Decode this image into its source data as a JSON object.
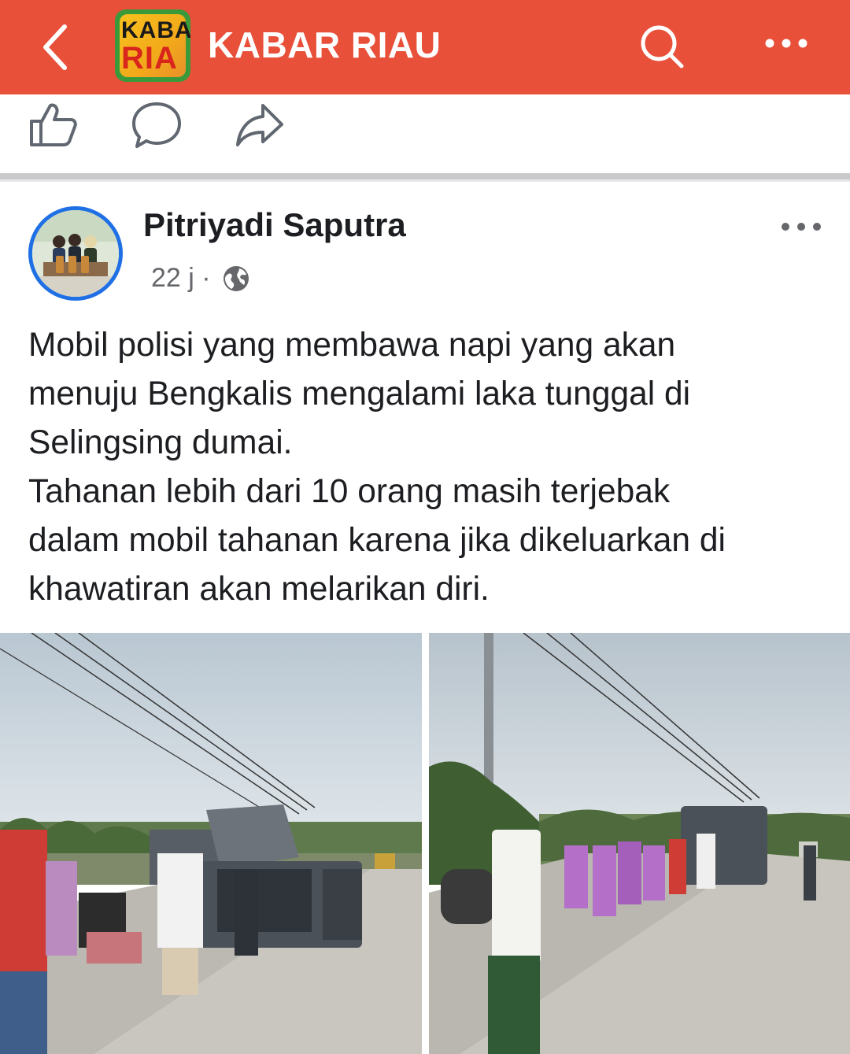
{
  "header": {
    "title": "KABAR RIAU",
    "logo_text_top": "KABA",
    "logo_text_bottom": "RIA",
    "back_icon": "chevron-left-icon",
    "search_icon": "search-icon",
    "more_icon": "more-horizontal-icon",
    "background_color": "#e8503a"
  },
  "actions": {
    "like_icon": "thumbs-up-icon",
    "comment_icon": "comment-icon",
    "share_icon": "share-icon"
  },
  "post": {
    "author": "Pitriyadi Saputra",
    "time": "22 j ·",
    "visibility_icon": "globe-icon",
    "text_lines": [
      "Mobil polisi yang membawa napi yang akan",
      "menuju Bengkalis mengalami laka tunggal di",
      "Selingsing dumai.",
      "Tahanan lebih dari 10 orang masih terjebak",
      "dalam mobil tahanan karena jika dikeluarkan di",
      "khawatiran akan melarikan diri."
    ],
    "accent_color": "#1f6fe5"
  }
}
